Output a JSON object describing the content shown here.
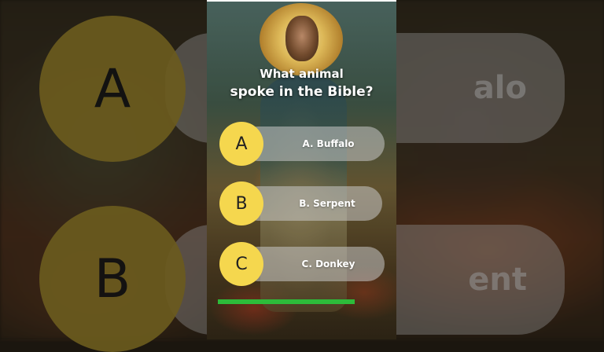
{
  "question": {
    "line1": "What animal",
    "line2": "spoke in the Bible?"
  },
  "options": [
    {
      "letter": "A",
      "label": "A. Buffalo"
    },
    {
      "letter": "B",
      "label": "B. Serpent"
    },
    {
      "letter": "C",
      "label": "C. Donkey"
    }
  ],
  "background_echo": {
    "circle_a": "A",
    "circle_b": "B",
    "pill_a_text": "alo",
    "pill_b_text": "ent"
  },
  "timer": {
    "progress": 1.0
  },
  "colors": {
    "option_circle": "#f5d74e",
    "timer_bar": "#2dbb3a",
    "option_pill": "rgba(200,200,200,0.55)"
  }
}
